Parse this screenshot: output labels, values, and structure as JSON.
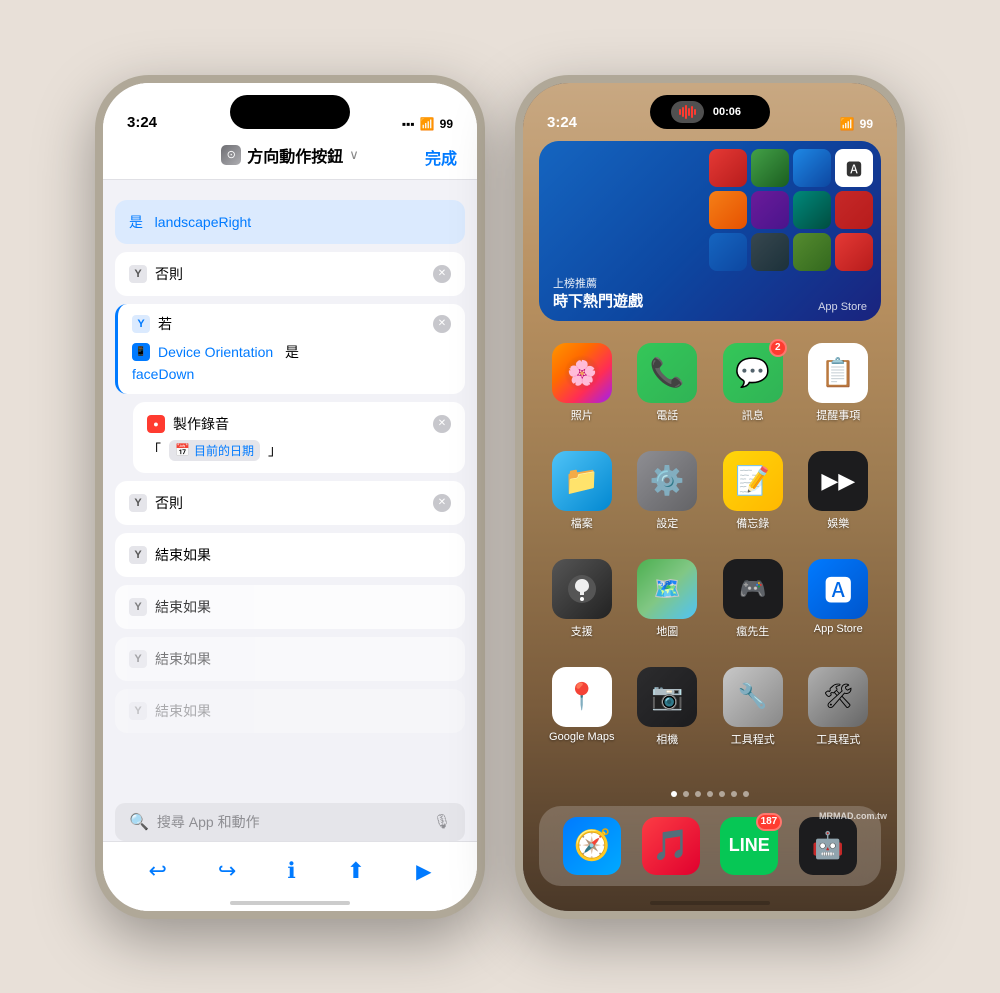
{
  "left_phone": {
    "status_time": "3:24",
    "status_signal": "●●●",
    "status_wifi": "WiFi",
    "status_battery": "99",
    "header_title": "方向動作按鈕",
    "done_label": "完成",
    "shortcuts": [
      {
        "type": "landscape",
        "label": "是  landscapeRight"
      },
      {
        "type": "else",
        "label": "否則"
      },
      {
        "type": "if_device",
        "label": "若",
        "device_label": "Device Orientation",
        "is_label": "是",
        "value": "faceDown"
      },
      {
        "type": "record",
        "label": "製作錄音",
        "subtext": "「 目前的日期 」"
      },
      {
        "type": "else",
        "label": "否則"
      },
      {
        "type": "endif",
        "label": "結束如果"
      },
      {
        "type": "endif2",
        "label": "結束如果"
      },
      {
        "type": "endif3",
        "label": "結束如果"
      },
      {
        "type": "endif4",
        "label": "結束如果"
      }
    ],
    "search_placeholder": "搜尋 App 和動作"
  },
  "right_phone": {
    "status_time": "3:24",
    "status_battery": "99",
    "rec_time": "00:06",
    "widget": {
      "label": "上榜推薦",
      "title": "時下熱門遊戲",
      "store_label": "App Store"
    },
    "rows": [
      [
        {
          "name": "照片",
          "icon_class": "icon-photos",
          "emoji": "🌅"
        },
        {
          "name": "電話",
          "icon_class": "icon-phone",
          "emoji": "📞"
        },
        {
          "name": "訊息",
          "icon_class": "icon-messages",
          "emoji": "💬",
          "badge": "2"
        },
        {
          "name": "提醒事項",
          "icon_class": "icon-reminders",
          "emoji": "📋"
        }
      ],
      [
        {
          "name": "檔案",
          "icon_class": "icon-files",
          "emoji": "📁"
        },
        {
          "name": "設定",
          "icon_class": "icon-settings",
          "emoji": "⚙️"
        },
        {
          "name": "備忘錄",
          "icon_class": "icon-notes",
          "emoji": "📝"
        },
        {
          "name": "娛樂",
          "icon_class": "icon-entertainment",
          "emoji": "▶"
        }
      ],
      [
        {
          "name": "支援",
          "icon_class": "icon-support",
          "emoji": ""
        },
        {
          "name": "地圖",
          "icon_class": "icon-maps",
          "emoji": "🗺️"
        },
        {
          "name": "瘋先生",
          "icon_class": "icon-zhaxiansheng",
          "emoji": "🎮"
        },
        {
          "name": "App Store",
          "icon_class": "icon-appstore",
          "emoji": "🅰"
        }
      ],
      [
        {
          "name": "Google Maps",
          "icon_class": "icon-googlemaps",
          "emoji": "📍"
        },
        {
          "name": "相機",
          "icon_class": "icon-camera",
          "emoji": "📷"
        },
        {
          "name": "工具程式",
          "icon_class": "icon-tools1",
          "emoji": "🔧"
        },
        {
          "name": "工具程式",
          "icon_class": "icon-tools2",
          "emoji": "⚙"
        }
      ]
    ],
    "dock": [
      {
        "name": "",
        "icon_class": "icon-safari",
        "emoji": "🧭"
      },
      {
        "name": "",
        "icon_class": "icon-music",
        "emoji": "🎵"
      },
      {
        "name": "",
        "icon_class": "icon-line",
        "emoji": "LINE",
        "badge": "187"
      },
      {
        "name": "",
        "icon_class": "icon-mrmad",
        "emoji": "🤖"
      }
    ],
    "watermark": "MRMAD.com.tw"
  }
}
